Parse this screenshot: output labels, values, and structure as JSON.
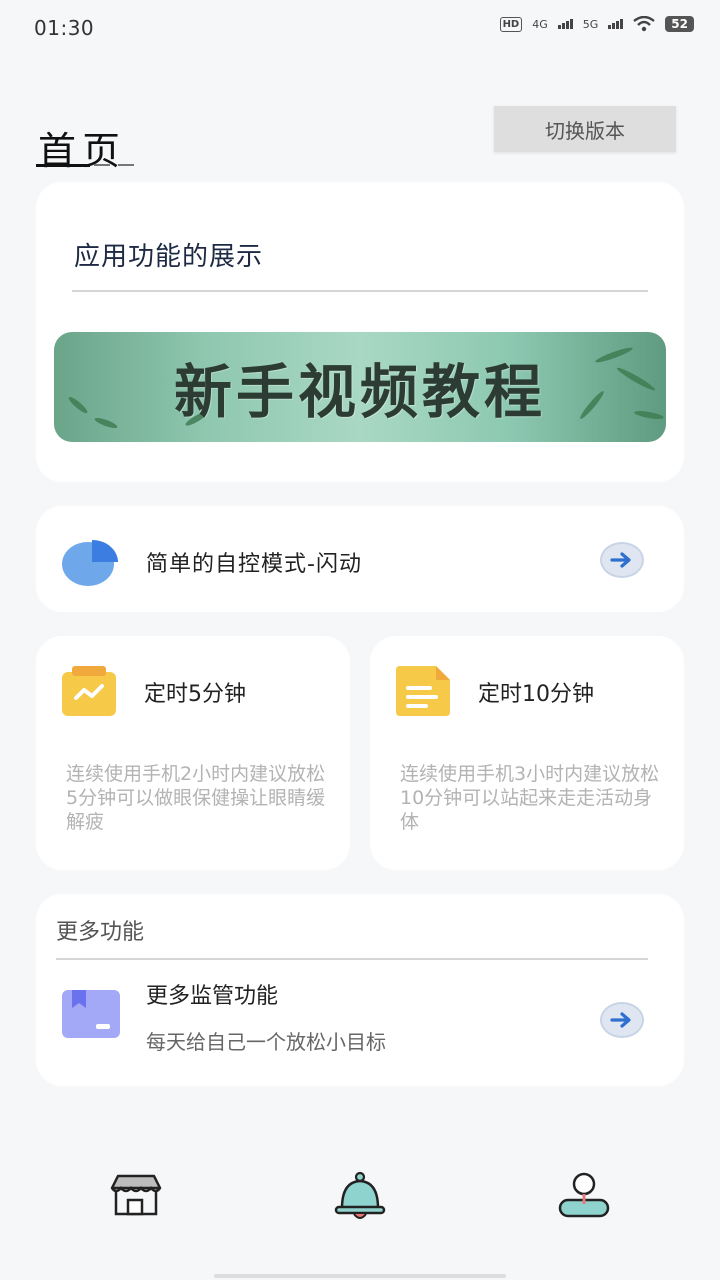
{
  "status_bar": {
    "time": "01:30",
    "hd": "HD",
    "net1": "4G",
    "net2": "5G",
    "battery": "52"
  },
  "header": {
    "title": "首页",
    "switch_button": "切换版本"
  },
  "showcase": {
    "title": "应用功能的展示",
    "banner_text": "新手视频教程"
  },
  "simple_mode": {
    "label": "简单的自控模式-闪动"
  },
  "timers": [
    {
      "title": "定时5分钟",
      "description": "连续使用手机2小时内建议放松5分钟可以做眼保健操让眼睛缓解疲"
    },
    {
      "title": "定时10分钟",
      "description": "连续使用手机3小时内建议放松10分钟可以站起来走走活动身体"
    }
  ],
  "more": {
    "heading": "更多功能",
    "item_title": "更多监管功能",
    "item_subtitle": "每天给自己一个放松小目标"
  },
  "icons": {
    "pie": "pie-chart-icon",
    "clipboard": "clipboard-chart-icon",
    "document": "document-icon",
    "box": "box-icon",
    "arrow": "arrow-right-icon",
    "tab_store": "store-icon",
    "tab_bell": "bell-icon",
    "tab_user": "user-icon"
  },
  "colors": {
    "accent_blue": "#3b7de0",
    "clipboard_yellow": "#f7c948",
    "box_purple": "#8f96f3",
    "tab_teal": "#8fd3cf"
  }
}
